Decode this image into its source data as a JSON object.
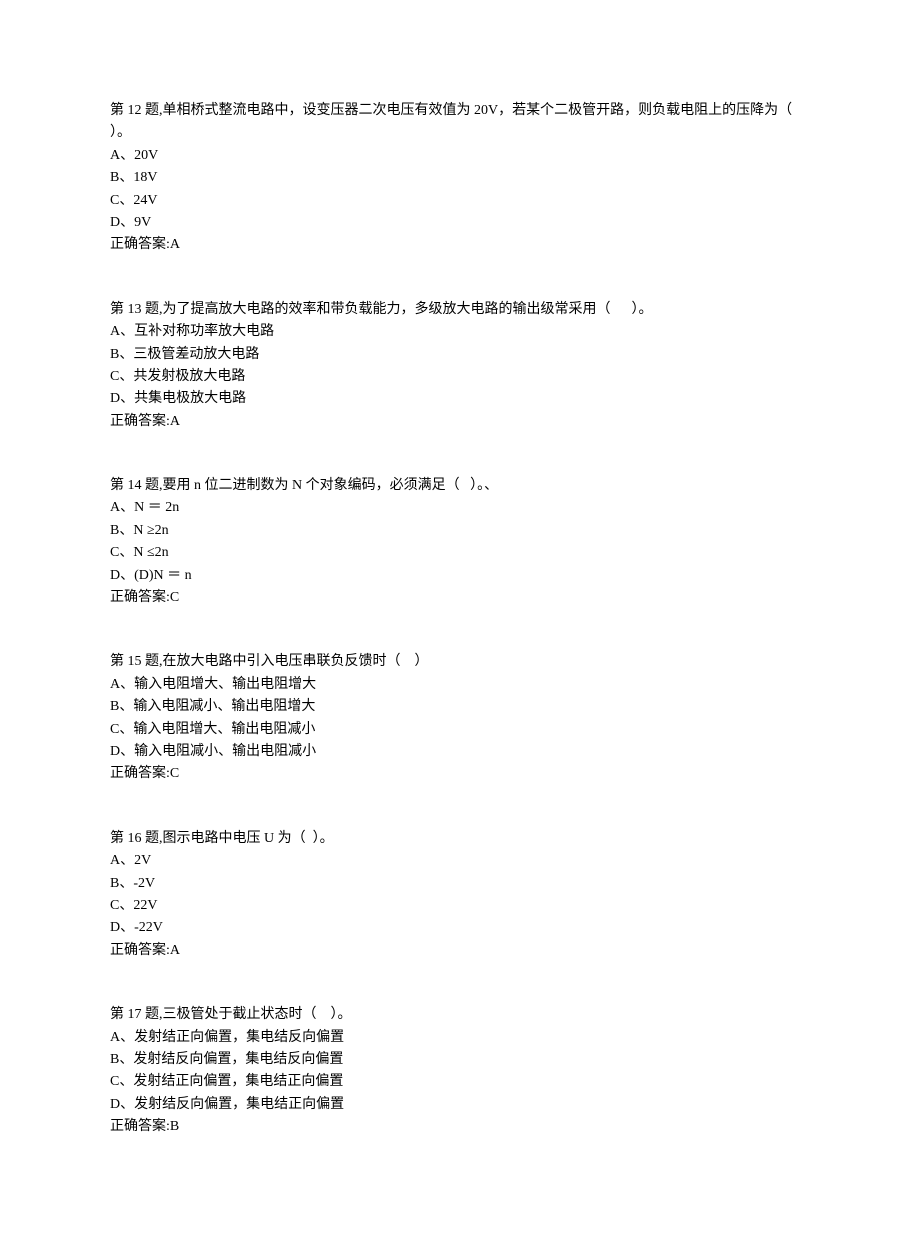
{
  "questions": [
    {
      "number": "第 12 题,",
      "stem": "单相桥式整流电路中，设变压器二次电压有效值为 20V，若某个二极管开路，则负载电阻上的压降为（   ）。",
      "options": [
        "A、20V",
        "B、18V",
        "C、24V",
        "D、9V"
      ],
      "answer_label": "正确答案:",
      "answer": "A"
    },
    {
      "number": "第 13 题,",
      "stem": "为了提高放大电路的效率和带负载能力，多级放大电路的输出级常采用（      ）。",
      "options": [
        "A、互补对称功率放大电路",
        "B、三极管差动放大电路",
        "C、共发射极放大电路",
        "D、共集电极放大电路"
      ],
      "answer_label": "正确答案:",
      "answer": "A"
    },
    {
      "number": "第 14 题,",
      "stem": "要用 n 位二进制数为 N 个对象编码，必须满足（   ）。、",
      "options": [
        "A、N ＝ 2n",
        "B、N ≥2n",
        "C、N ≤2n",
        "D、(D)N ＝ n"
      ],
      "answer_label": "正确答案:",
      "answer": "C"
    },
    {
      "number": "第 15 题,",
      "stem": "在放大电路中引入电压串联负反馈时（    ）",
      "options": [
        "A、输入电阻增大、输出电阻增大",
        "B、输入电阻减小、输出电阻增大",
        "C、输入电阻增大、输出电阻减小",
        "D、输入电阻减小、输出电阻减小"
      ],
      "answer_label": "正确答案:",
      "answer": "C"
    },
    {
      "number": "第 16 题,",
      "stem": "图示电路中电压 U 为（  ）。",
      "options": [
        "A、2V",
        "B、-2V",
        "C、22V",
        "D、-22V"
      ],
      "answer_label": "正确答案:",
      "answer": "A"
    },
    {
      "number": "第 17 题,",
      "stem": "三极管处于截止状态时（    ）。",
      "options": [
        "A、发射结正向偏置，集电结反向偏置",
        "B、发射结反向偏置，集电结反向偏置",
        "C、发射结正向偏置，集电结正向偏置",
        "D、发射结反向偏置，集电结正向偏置"
      ],
      "answer_label": "正确答案:",
      "answer": "B"
    }
  ]
}
